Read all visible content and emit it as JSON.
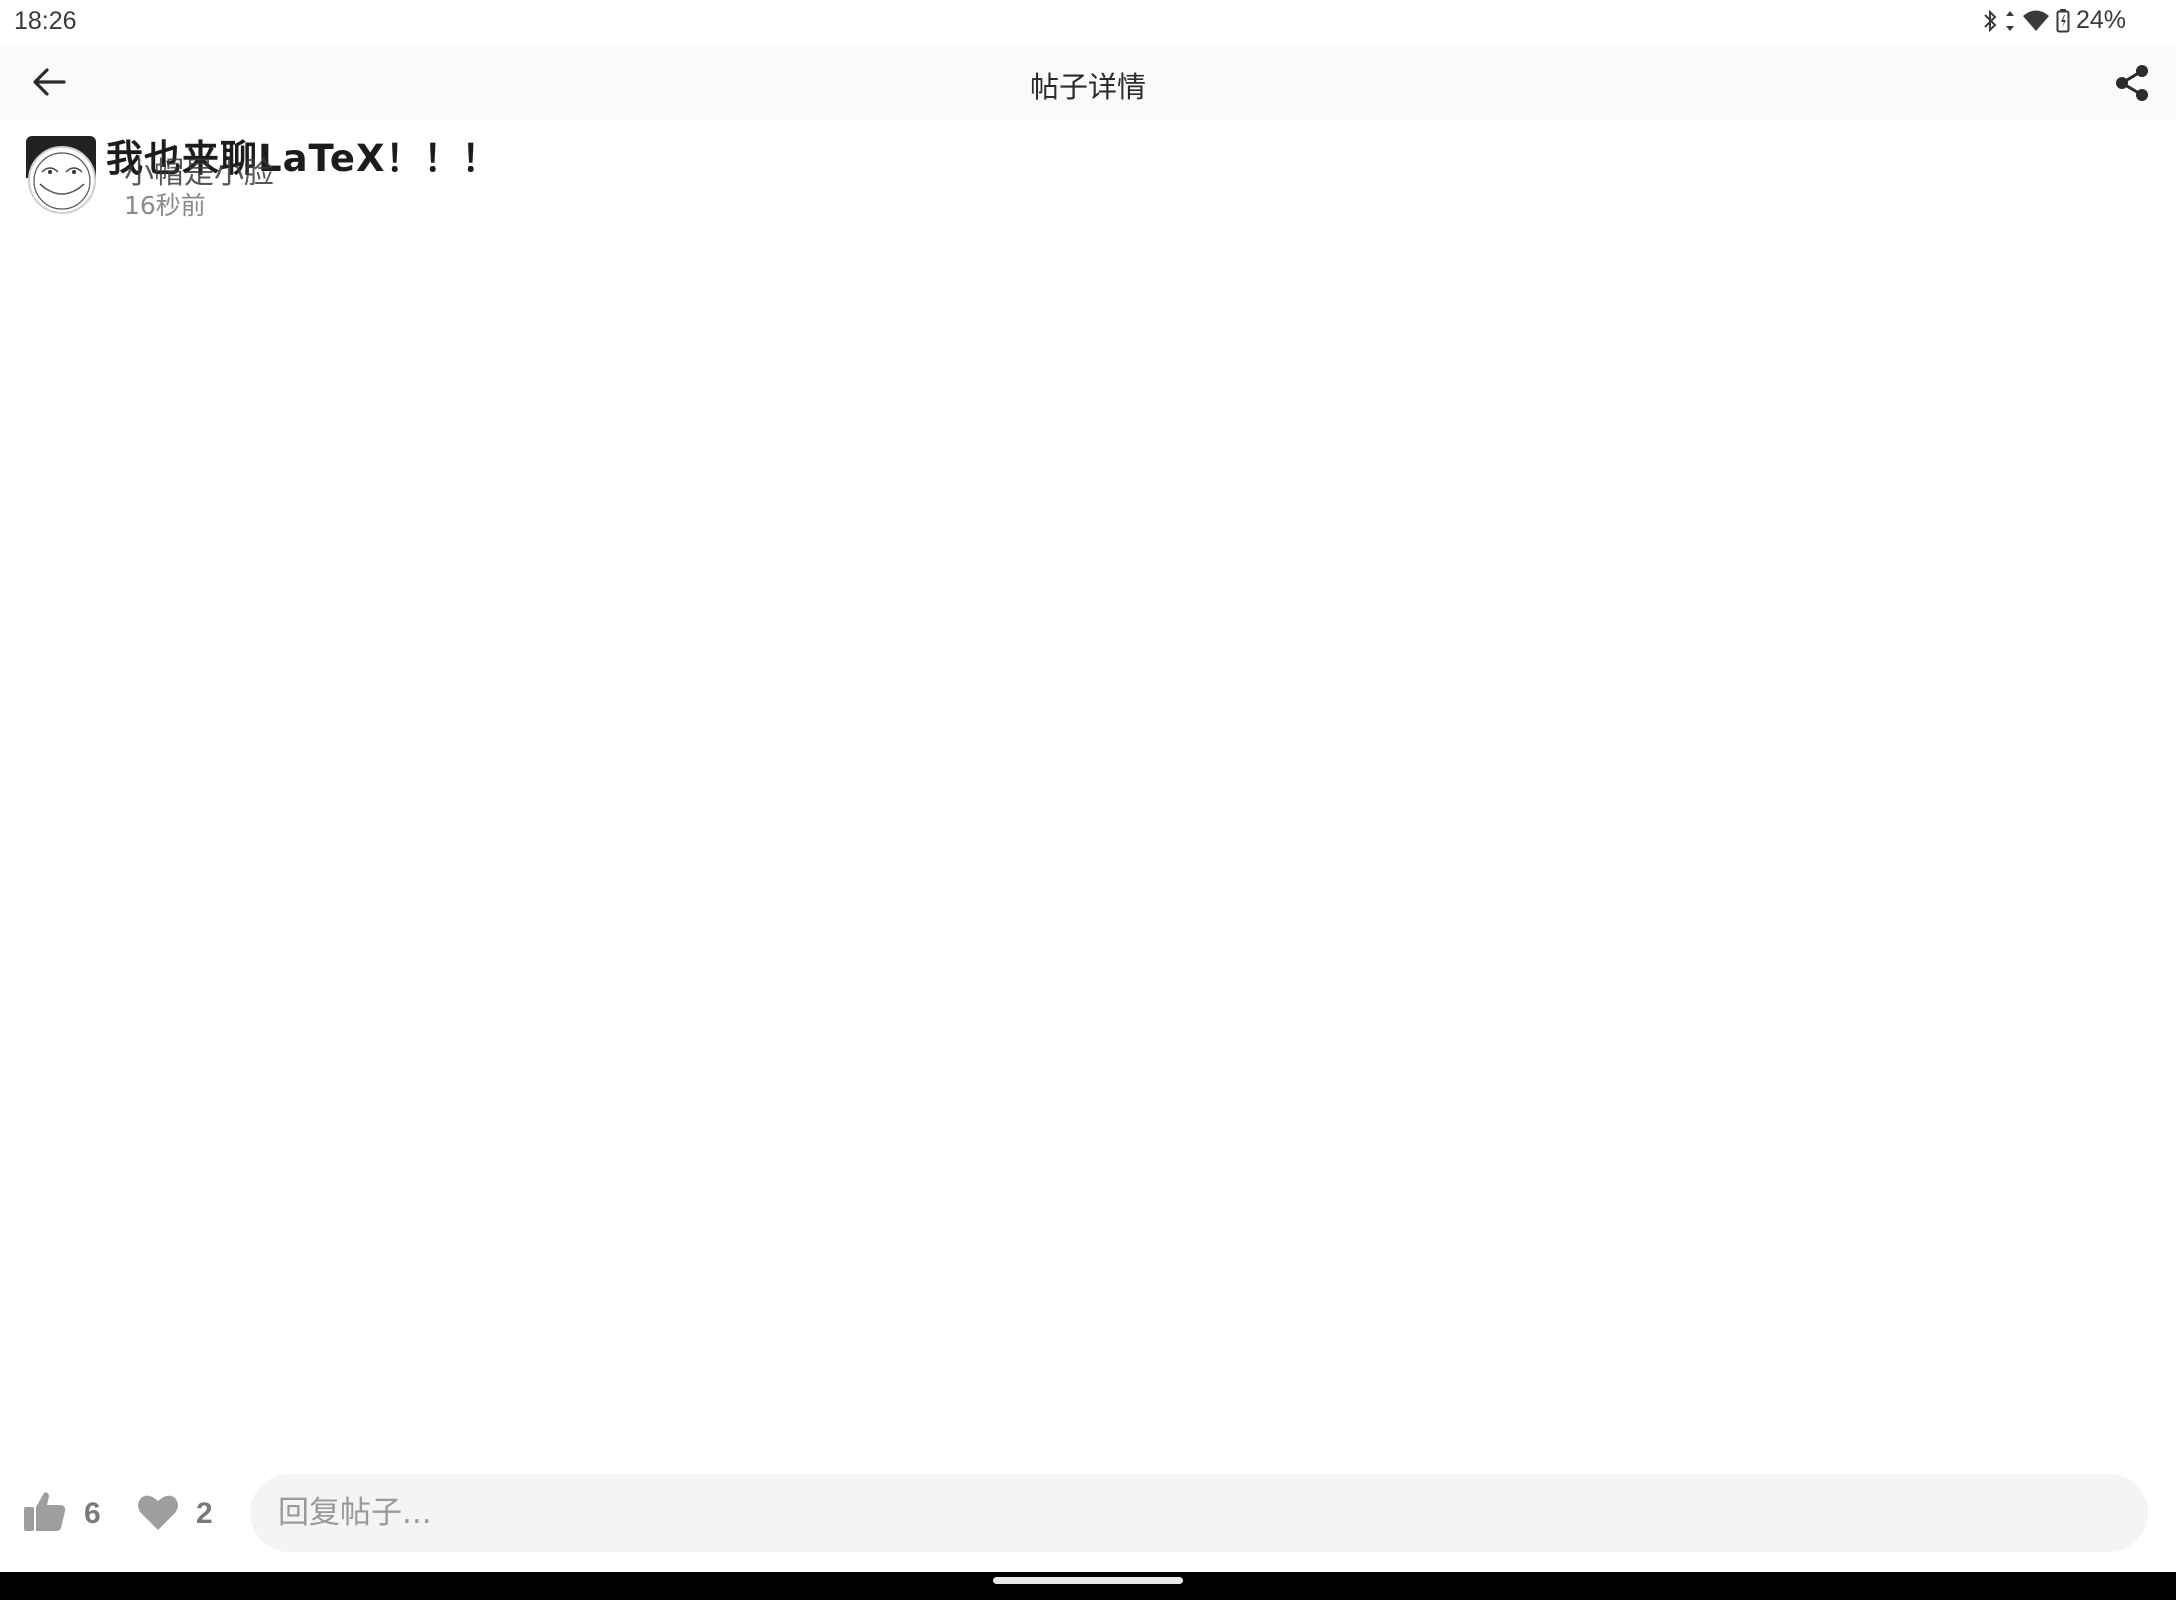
{
  "status_bar": {
    "time": "18:26",
    "battery": "24%",
    "icons": [
      "bluetooth-icon",
      "data-arrows-icon",
      "wifi-icon",
      "battery-icon"
    ]
  },
  "app_bar": {
    "title": "帖子详情",
    "back_icon": "arrow-left-icon",
    "share_icon": "share-icon"
  },
  "post": {
    "title": "我也来聊LaTeX！！！",
    "author": "小帽是小脸",
    "time": "16秒前",
    "avatar_icon": "smiley-face-icon"
  },
  "actions": {
    "like_icon": "thumbs-up-icon",
    "like_count": "6",
    "favorite_icon": "heart-icon",
    "favorite_count": "2",
    "reply_placeholder": "回复帖子..."
  },
  "colors": {
    "app_bar_bg": "#fafafa",
    "reply_input_bg": "#f3f4f3",
    "icon_gray": "#9e9e9e",
    "nav_bar_bg": "#000000"
  }
}
